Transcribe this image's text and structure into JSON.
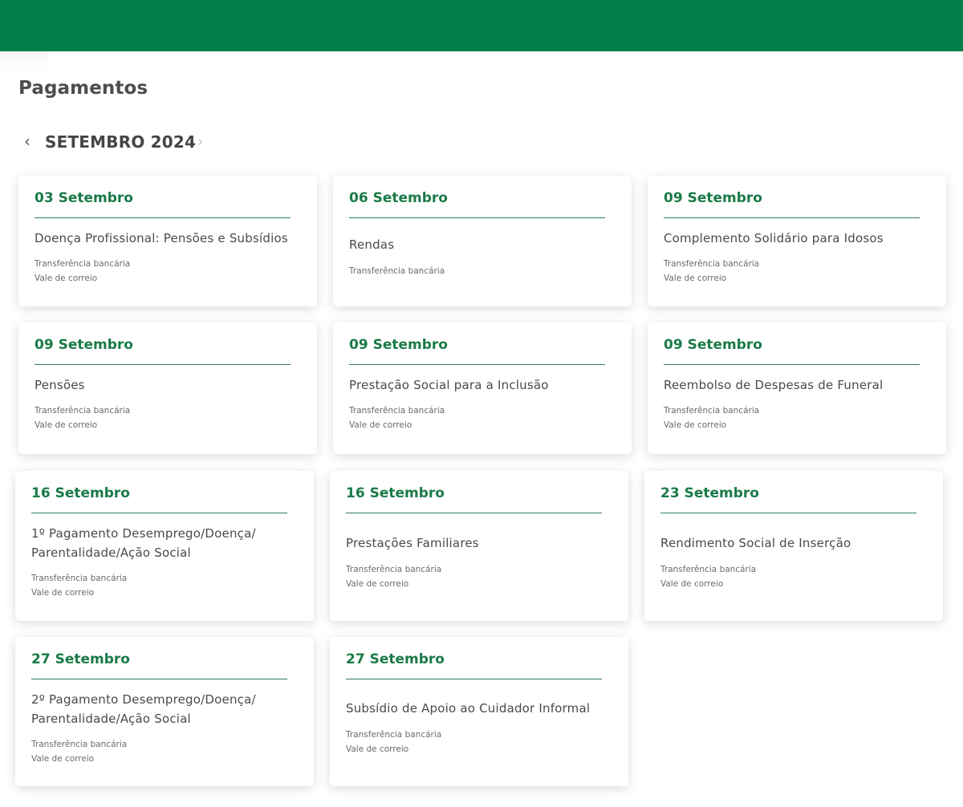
{
  "header": {
    "brand_color": "#007e47"
  },
  "page": {
    "title": "Pagamentos"
  },
  "month_nav": {
    "label": "SETEMBRO 2024",
    "prev_icon": "chevron-left-icon",
    "next_icon": "chevron-right-icon"
  },
  "cards": [
    {
      "date": "03 Setembro",
      "title": "Doença Profissional: Pensões e Subsídios",
      "methods": [
        "Transferência bancária",
        "Vale de correio"
      ]
    },
    {
      "date": "06 Setembro",
      "title": "Rendas",
      "methods": [
        "Transferência bancária"
      ]
    },
    {
      "date": "09 Setembro",
      "title": "Complemento Solidário para Idosos",
      "methods": [
        "Transferência bancária",
        "Vale de correio"
      ]
    },
    {
      "date": "09 Setembro",
      "title": "Pensões",
      "methods": [
        "Transferência bancária",
        "Vale de correio"
      ]
    },
    {
      "date": "09 Setembro",
      "title": "Prestação Social para a Inclusão",
      "methods": [
        "Transferência bancária",
        "Vale de correio"
      ]
    },
    {
      "date": "09 Setembro",
      "title": "Reembolso de Despesas de Funeral",
      "methods": [
        "Transferência bancária",
        "Vale de correio"
      ]
    },
    {
      "date": "16 Setembro",
      "title": "1º Pagamento Desemprego/Doença/ Parentalidade/Ação Social",
      "methods": [
        "Transferência bancária",
        "Vale de correio"
      ]
    },
    {
      "date": "16 Setembro",
      "title": "Prestações Familiares",
      "methods": [
        "Transferência bancária",
        "Vale de correio"
      ]
    },
    {
      "date": "23 Setembro",
      "title": "Rendimento Social de Inserção",
      "methods": [
        "Transferência bancária",
        "Vale de correio"
      ]
    },
    {
      "date": "27 Setembro",
      "title": "2º Pagamento Desemprego/Doença/ Parentalidade/Ação Social",
      "methods": [
        "Transferência bancária",
        "Vale de correio"
      ]
    },
    {
      "date": "27 Setembro",
      "title": "Subsídio de Apoio ao Cuidador Informal",
      "methods": [
        "Transferência bancária",
        "Vale de correio"
      ]
    }
  ]
}
